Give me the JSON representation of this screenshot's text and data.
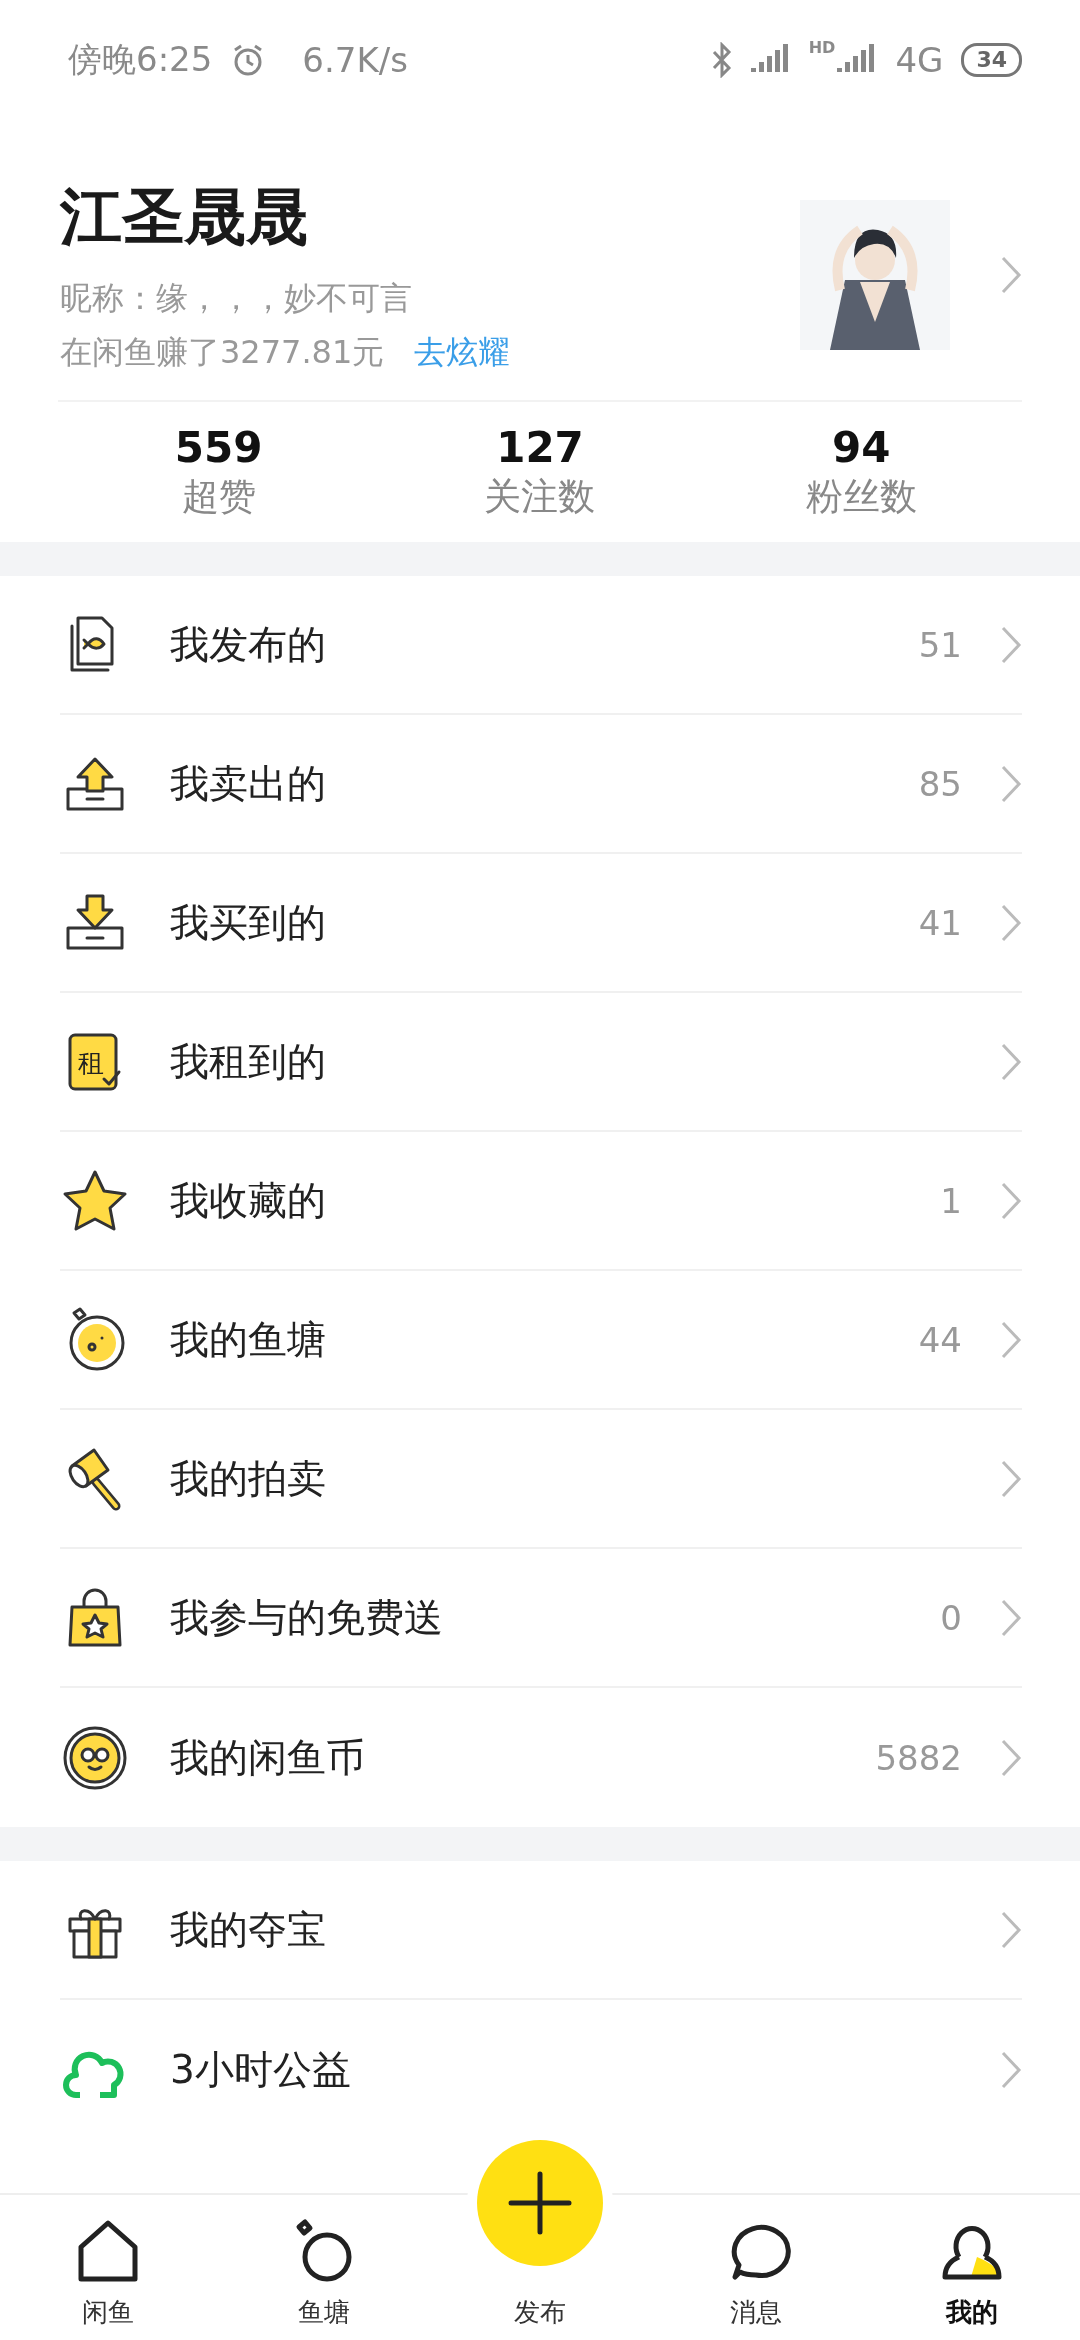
{
  "status_bar": {
    "time": "傍晚6:25",
    "speed": "6.7K/s",
    "network_badge": "HD",
    "network": "4G",
    "battery": "34"
  },
  "profile": {
    "name": "江圣晟晟",
    "nickname": "昵称：缘，，，妙不可言",
    "earnings": "在闲鱼赚了3277.81元",
    "earnings_link": "去炫耀"
  },
  "stats": [
    {
      "value": "559",
      "label": "超赞"
    },
    {
      "value": "127",
      "label": "关注数"
    },
    {
      "value": "94",
      "label": "粉丝数"
    }
  ],
  "menu_groups": [
    {
      "items": [
        {
          "kind": "document",
          "label": "我发布的",
          "count": "51"
        },
        {
          "kind": "upload",
          "label": "我卖出的",
          "count": "85"
        },
        {
          "kind": "download",
          "label": "我买到的",
          "count": "41"
        },
        {
          "kind": "rent",
          "icon_text": "租",
          "label": "我租到的"
        },
        {
          "kind": "star",
          "label": "我收藏的",
          "count": "1"
        },
        {
          "kind": "pond",
          "label": "我的鱼塘",
          "count": "44"
        },
        {
          "kind": "hammer",
          "label": "我的拍卖"
        },
        {
          "kind": "bag",
          "label": "我参与的免费送",
          "count": "0"
        },
        {
          "kind": "coin",
          "label": "我的闲鱼币",
          "count": "5882"
        }
      ]
    },
    {
      "items": [
        {
          "kind": "gift",
          "label": "我的夺宝"
        },
        {
          "kind": "charity",
          "label": "3小时公益"
        }
      ]
    }
  ],
  "tab_bar": [
    {
      "kind": "home",
      "label": "闲鱼",
      "selected": false
    },
    {
      "kind": "pond",
      "label": "鱼塘",
      "selected": false
    },
    {
      "kind": "publish",
      "label": "发布",
      "selected": false
    },
    {
      "kind": "message",
      "label": "消息",
      "selected": false
    },
    {
      "kind": "profile",
      "label": "我的",
      "selected": true
    }
  ]
}
